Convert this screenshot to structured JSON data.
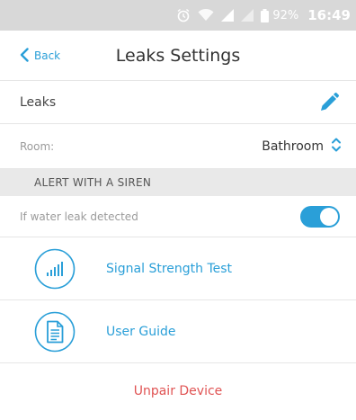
{
  "status_bar": {
    "battery": "92%",
    "time": "16:49",
    "icons": [
      "alarm-icon",
      "wifi-icon",
      "signal-icon",
      "signal-icon",
      "battery-icon"
    ]
  },
  "nav": {
    "back_label": "Back",
    "title": "Leaks Settings"
  },
  "device": {
    "name": "Leaks",
    "edit_icon": "pencil-icon"
  },
  "room": {
    "label": "Room:",
    "value": "Bathroom"
  },
  "alert_section": {
    "header": "ALERT WITH A SIREN",
    "toggle_label": "If water leak detected",
    "toggle_on": true
  },
  "links": {
    "signal_test": "Signal Strength Test",
    "user_guide": "User Guide"
  },
  "unpair_label": "Unpair Device",
  "colors": {
    "accent": "#2a9fd8",
    "danger": "#e05353",
    "status_bar_bg": "#d8d8d8",
    "section_bg": "#e9e9e9"
  }
}
